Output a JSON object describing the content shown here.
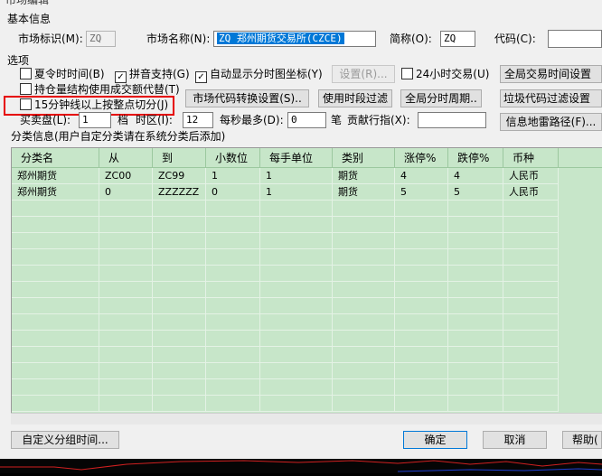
{
  "window": {
    "title": "市场编辑"
  },
  "basic": {
    "section_label": "基本信息",
    "market_id_label": "市场标识(M):",
    "market_id_value": "ZQ",
    "market_name_label": "市场名称(N):",
    "market_name_value": "ZQ 郑州期货交易所(CZCE)",
    "short_name_label": "简称(O):",
    "short_name_value": "ZQ",
    "code_label": "代码(C):",
    "code_value": ""
  },
  "options": {
    "section_label": "选项",
    "summer_time": {
      "label": "夏令时时间(B)",
      "checked": false
    },
    "pinyin": {
      "label": "拼音支持(G)",
      "checked": true
    },
    "auto_axis": {
      "label": "自动显示分时图坐标(Y)",
      "checked": true
    },
    "settings_label": "设置(R)...",
    "h24": {
      "label": "24小时交易(U)",
      "checked": false
    },
    "global_time_label": "全局交易时间设置(A)",
    "open_interest": {
      "label": "持仓量结构使用成交额代替(T)",
      "checked": false
    },
    "market_code_conv_label": "市场代码转换设置(S)..",
    "time_filter_label": "使用时段过滤",
    "global_period_label": "全局分时周期..",
    "junk_filter_label": "垃圾代码过滤设置(E)",
    "split15": {
      "label": "15分钟线以上按整点切分(J)",
      "checked": false
    },
    "depth_label": "买卖盘(L):",
    "depth_value": "1",
    "depth_unit": "档",
    "tz_label": "时区(I):",
    "tz_value": "12",
    "per_sec_label": "每秒最多(D):",
    "per_sec_value": "0",
    "per_sec_unit": "笔",
    "contrib_label": "贡献行指(X):",
    "contrib_value": "",
    "info_path_label": "信息地雷路径(F)..."
  },
  "categories": {
    "section_label": "分类信息(用户自定分类请在系统分类后添加)",
    "columns": [
      "分类名",
      "从",
      "到",
      "小数位",
      "每手单位",
      "类别",
      "涨停%",
      "跌停%",
      "币种"
    ],
    "rows": [
      [
        "郑州期货",
        "ZC00",
        "ZC99",
        "1",
        "1",
        "期货",
        "4",
        "4",
        "人民币"
      ],
      [
        "郑州期货",
        "0",
        "ZZZZZZ",
        "0",
        "1",
        "期货",
        "5",
        "5",
        "人民币"
      ]
    ]
  },
  "footer": {
    "custom_group_label": "自定义分组时间...",
    "ok_label": "确定",
    "cancel_label": "取消",
    "help_label": "帮助("
  },
  "colors": {
    "grid_bg": "#c7e6c9",
    "selection": "#0078d7",
    "highlight": "#e60000"
  }
}
